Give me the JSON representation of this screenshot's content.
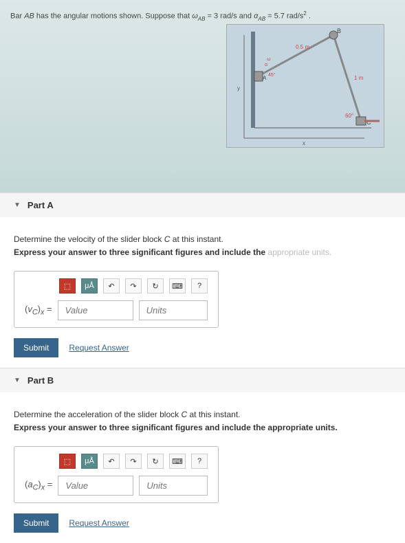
{
  "problem": {
    "prefix": "Bar ",
    "bar": "AB",
    "mid": " has the angular motions shown. Suppose that ",
    "omega_var": "ω",
    "omega_sub": "AB",
    "omega_val": " = 3 rad/s",
    "and": " and ",
    "alpha_var": "α",
    "alpha_sub": "AB",
    "alpha_val": " = 5.7 rad/s",
    "alpha_exp": "2",
    "end": " ."
  },
  "diagram": {
    "label_05m": "0.5 m",
    "label_1m": "1 m",
    "label_B": "B",
    "label_C": "C",
    "label_A": "A",
    "label_45": "45°",
    "label_60": "60°",
    "label_omega": "ω",
    "label_alpha": "α",
    "label_x": "x",
    "label_y": "y"
  },
  "partA": {
    "title": "Part A",
    "question_pre": "Determine the velocity of the slider block ",
    "question_var": "C",
    "question_post": " at this instant.",
    "instruction": "Express your answer to three significant figures and include the ",
    "instruction_faded": "appropriate units.",
    "var_label": "(vC)x =",
    "value_placeholder": "Value",
    "units_placeholder": "Units",
    "submit": "Submit",
    "request": "Request Answer"
  },
  "partB": {
    "title": "Part B",
    "question_pre": "Determine the acceleration of the slider block ",
    "question_var": "C",
    "question_post": " at this instant.",
    "instruction": "Express your answer to three significant figures and include the appropriate units.",
    "var_label": "(aC)x =",
    "value_placeholder": "Value",
    "units_placeholder": "Units",
    "submit": "Submit",
    "request": "Request Answer"
  },
  "toolbar": {
    "templates": "⬚",
    "mu": "μÅ",
    "undo": "↶",
    "redo": "↷",
    "reset": "↻",
    "keyboard": "⌨",
    "help": "?"
  }
}
